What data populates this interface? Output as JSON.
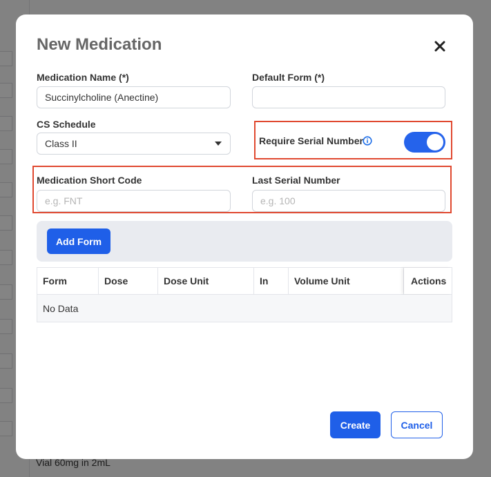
{
  "background": {
    "footer_text": "Vial 60mg in 2mL"
  },
  "modal": {
    "title": "New Medication",
    "close_icon": "close-icon",
    "fields": {
      "medication_name": {
        "label": "Medication Name (*)",
        "value": "Succinylcholine (Anectine)",
        "placeholder": ""
      },
      "default_form": {
        "label": "Default Form (*)",
        "value": "",
        "placeholder": ""
      },
      "cs_schedule": {
        "label": "CS Schedule",
        "value": "Class II"
      },
      "require_serial": {
        "label": "Require Serial Number",
        "info_icon": "info-icon",
        "enabled": true
      },
      "short_code": {
        "label": "Medication Short Code",
        "value": "",
        "placeholder": "e.g. FNT"
      },
      "last_serial": {
        "label": "Last Serial Number",
        "value": "",
        "placeholder": "e.g. 100"
      }
    },
    "add_form_button": "Add Form",
    "table": {
      "columns": [
        "Form",
        "Dose",
        "Dose Unit",
        "In",
        "Volume Unit",
        "Actions"
      ],
      "empty_text": "No Data"
    },
    "create_button": "Create",
    "cancel_button": "Cancel"
  },
  "colors": {
    "primary": "#1f5fe8",
    "highlight": "#e0482f",
    "toggle_on": "#2563eb"
  }
}
